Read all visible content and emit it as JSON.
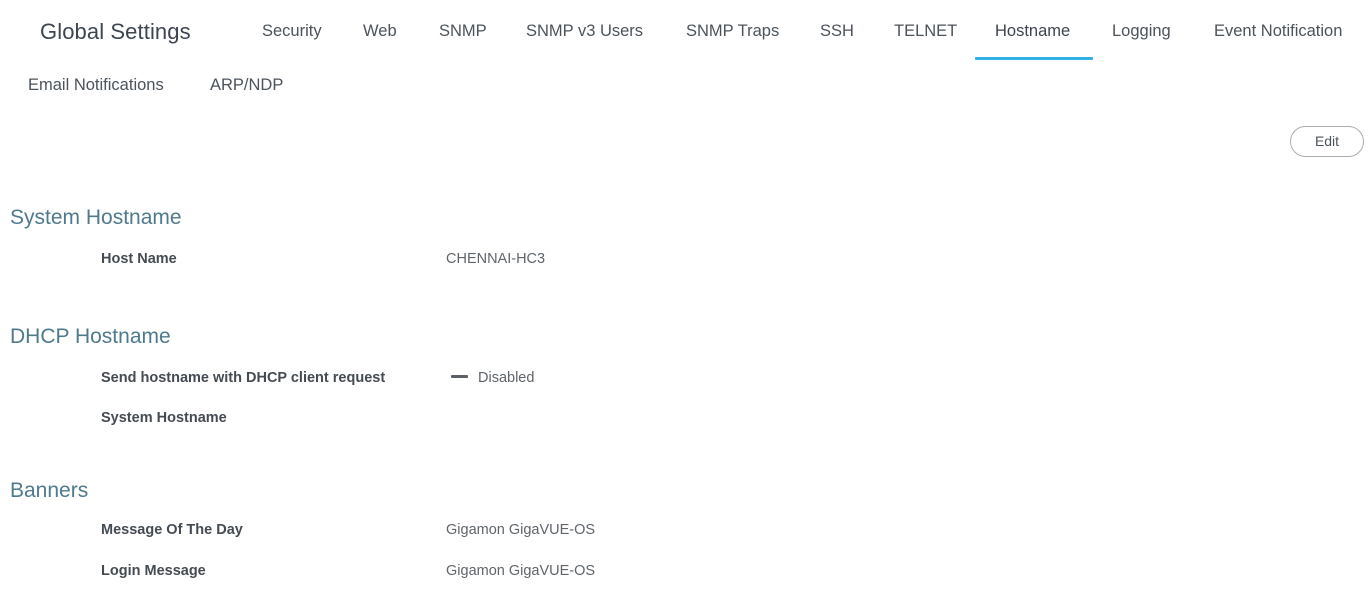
{
  "header": {
    "title": "Global Settings",
    "tabs": [
      {
        "label": "Security"
      },
      {
        "label": "Web"
      },
      {
        "label": "SNMP"
      },
      {
        "label": "SNMP v3 Users"
      },
      {
        "label": "SNMP Traps"
      },
      {
        "label": "SSH"
      },
      {
        "label": "TELNET"
      },
      {
        "label": "Hostname",
        "active": true
      },
      {
        "label": "Logging"
      },
      {
        "label": "Event Notification"
      },
      {
        "label": "Email Notifications"
      },
      {
        "label": "ARP/NDP"
      }
    ],
    "active_tab_color": "#31b0e6"
  },
  "actions": {
    "edit_label": "Edit"
  },
  "sections": {
    "system_hostname": {
      "title": "System Hostname",
      "fields": [
        {
          "label": "Host Name",
          "value": "CHENNAI-HC3"
        }
      ]
    },
    "dhcp_hostname": {
      "title": "DHCP Hostname",
      "fields": [
        {
          "label": "Send hostname with DHCP client request",
          "value": "Disabled",
          "icon": "dash-icon"
        },
        {
          "label": "System Hostname",
          "value": ""
        }
      ]
    },
    "banners": {
      "title": "Banners",
      "fields": [
        {
          "label": "Message Of The Day",
          "value": "Gigamon GigaVUE-OS"
        },
        {
          "label": "Login Message",
          "value": "Gigamon GigaVUE-OS"
        }
      ]
    }
  },
  "colors": {
    "section_title": "#4f7a8e",
    "text": "#454b52"
  }
}
